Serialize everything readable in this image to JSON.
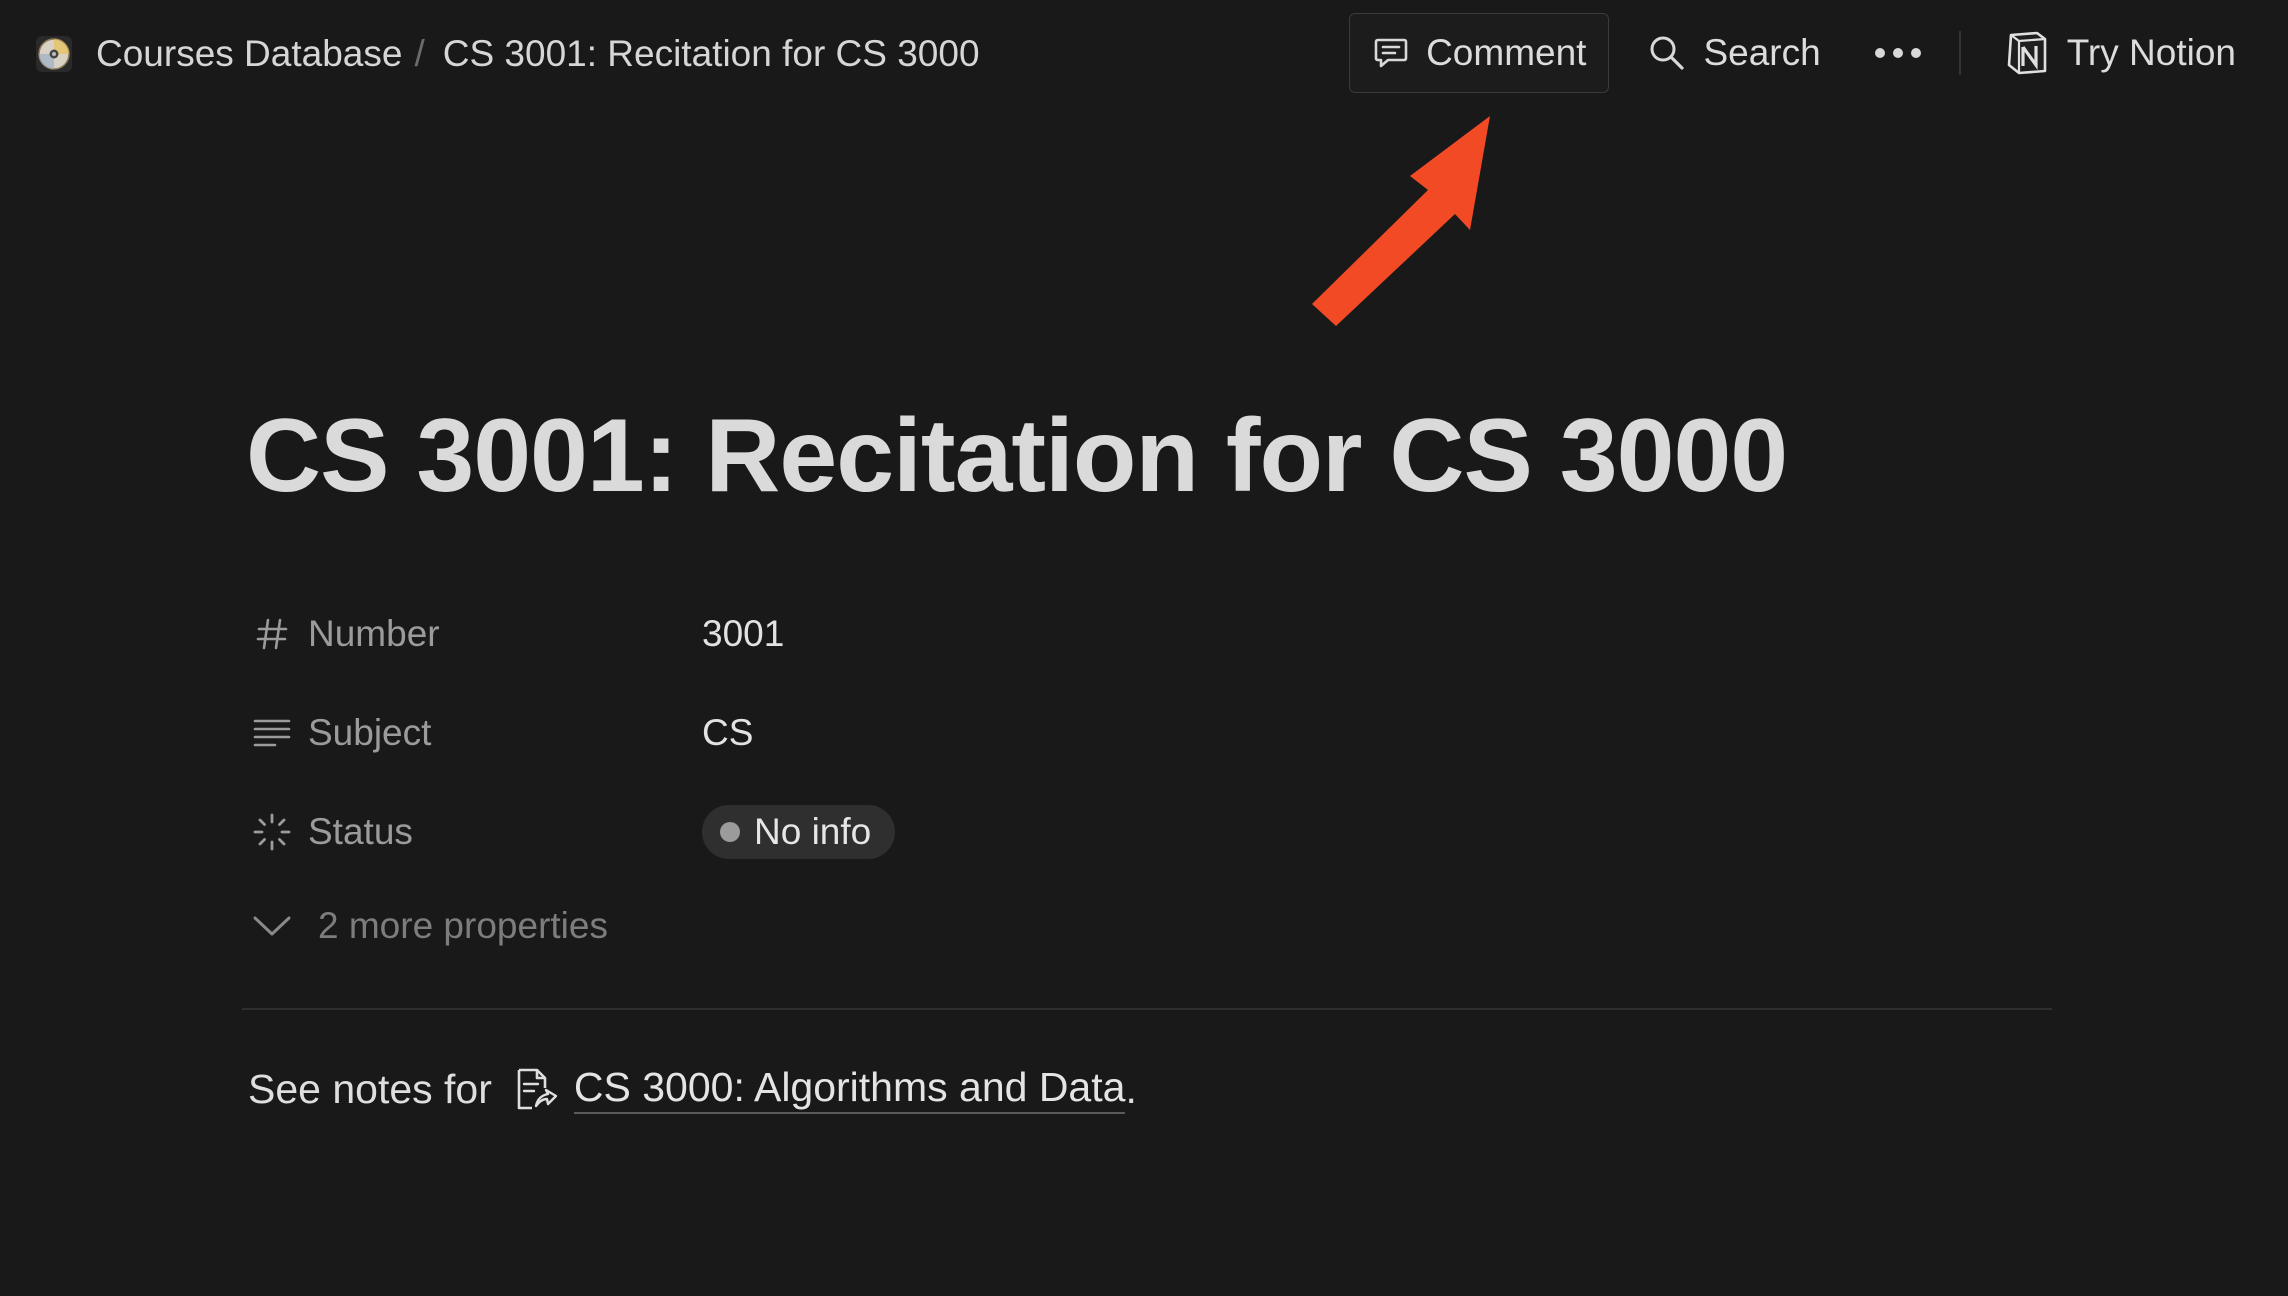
{
  "breadcrumb": {
    "database": "Courses Database",
    "separator": "/",
    "page": "CS 3001: Recitation for CS 3000"
  },
  "topbar": {
    "comment_label": "Comment",
    "search_label": "Search",
    "more_label": "•••",
    "try_notion_label": "Try Notion"
  },
  "page": {
    "title": "CS 3001: Recitation for CS 3000"
  },
  "properties": [
    {
      "name": "Number",
      "icon": "hash-icon",
      "value": "3001"
    },
    {
      "name": "Subject",
      "icon": "text-lines-icon",
      "value": "CS"
    },
    {
      "name": "Status",
      "icon": "status-spinner-icon",
      "value": "No info"
    }
  ],
  "more_properties_label": "2 more properties",
  "body": {
    "notes_prefix": "See notes for",
    "notes_link": "CS 3000: Algorithms and Data",
    "notes_suffix": "."
  },
  "colors": {
    "background": "#191919",
    "annotation_arrow": "#f24a25",
    "status_dot": "#9b9b9b"
  }
}
